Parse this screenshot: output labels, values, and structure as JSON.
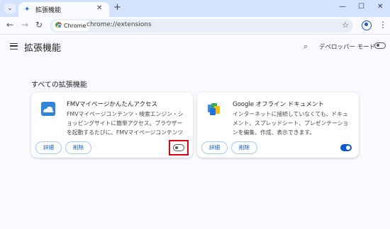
{
  "tab": {
    "title": "拡張機能",
    "icon": "puzzle-icon"
  },
  "toolbar": {
    "chip_label": "Chrome",
    "url": "chrome://extensions"
  },
  "header": {
    "title": "拡張機能",
    "dev_mode_label": "デベロッパー モード",
    "dev_mode_enabled": false
  },
  "section": {
    "title": "すべての拡張機能"
  },
  "extensions": [
    {
      "name": "FMVマイページかんたんアクセス",
      "description": "FMVマイページコンテンツ・検索エンジン・ショッピングサイトに簡単アクセス。ブラウザーを起動するたびに、FMVマイページコンテンツやウェ",
      "details_label": "詳細",
      "remove_label": "削除",
      "enabled": false
    },
    {
      "name": "Google オフライン ドキュメント",
      "description": "インターネットに接続していなくても、ドキュメント、スプレッドシート、プレゼンテーションを編集、作成、表示できます。",
      "details_label": "詳細",
      "remove_label": "削除",
      "enabled": true
    }
  ],
  "colors": {
    "accent": "#0b57d0",
    "highlight": "#e60012"
  }
}
